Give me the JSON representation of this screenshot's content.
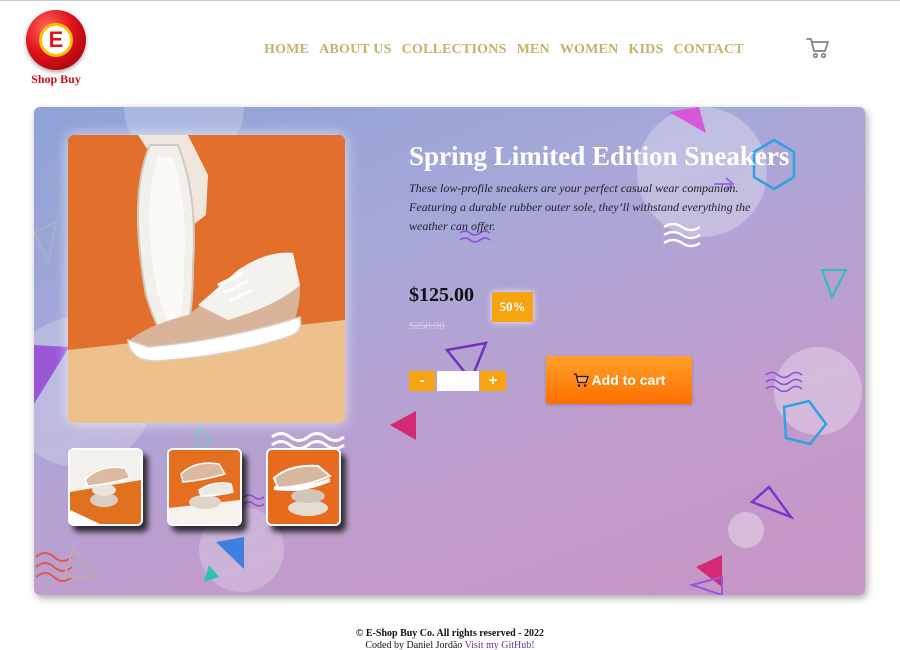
{
  "brand": {
    "logo_letter": "E",
    "logo_text": "Shop Buy"
  },
  "nav": {
    "items": [
      "HOME",
      "ABOUT US",
      "COLLECTIONS",
      "MEN",
      "WOMEN",
      "KIDS",
      "CONTACT"
    ]
  },
  "header": {
    "cart_icon": "cart-icon"
  },
  "product": {
    "title": "Spring Limited Edition Sneakers",
    "description": "These low-profile sneakers are your perfect casual wear companion. Featuring a durable rubber outer sole, they’ll withstand everything the weather can offer.",
    "price": "$125.00",
    "discount": "50%",
    "old_price": "$250.00",
    "quantity": {
      "minus_label": "-",
      "plus_label": "+",
      "value": ""
    },
    "add_to_cart_label": "Add to cart",
    "images": {
      "main": "sneaker-main-image",
      "thumbnails": [
        "sneaker-thumbnail-1",
        "sneaker-thumbnail-2",
        "sneaker-thumbnail-3"
      ]
    }
  },
  "footer": {
    "copyright": "© E-Shop Buy Co. All rights reserved - 2022",
    "coded_by": "Coded by Daniel Jordão",
    "github_link": "Visit my GitHub!"
  },
  "colors": {
    "nav_text": "#c6b06a",
    "accent_orange": "#f7a412",
    "button_gradient_start": "#ffa12a",
    "button_gradient_end": "#ff6f00",
    "card_gradient_start": "#8fa2d6",
    "card_gradient_end": "#c795c6",
    "title_text": "#ffffff",
    "old_price_text": "#d8c9e6",
    "github_link": "#6b2f8f"
  }
}
